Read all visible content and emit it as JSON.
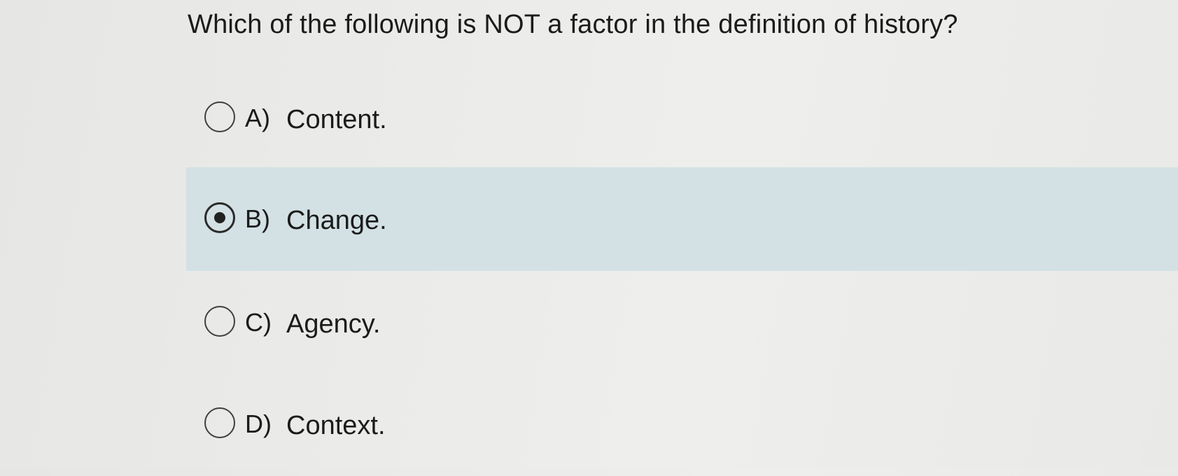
{
  "question": {
    "text": "Which of the following is NOT a factor in the definition of history?"
  },
  "options": [
    {
      "letter": "A)",
      "label": "Content.",
      "selected": false
    },
    {
      "letter": "B)",
      "label": "Change.",
      "selected": true
    },
    {
      "letter": "C)",
      "label": "Agency.",
      "selected": false
    },
    {
      "letter": "D)",
      "label": "Context.",
      "selected": false
    }
  ],
  "colors": {
    "selected_row_background": "#d3e1e4",
    "page_background": "#ebebe9",
    "text": "#1b1b1b"
  },
  "icons": {
    "unselected_option": "radio-unchecked-icon",
    "selected_option": "radio-checked-icon"
  }
}
